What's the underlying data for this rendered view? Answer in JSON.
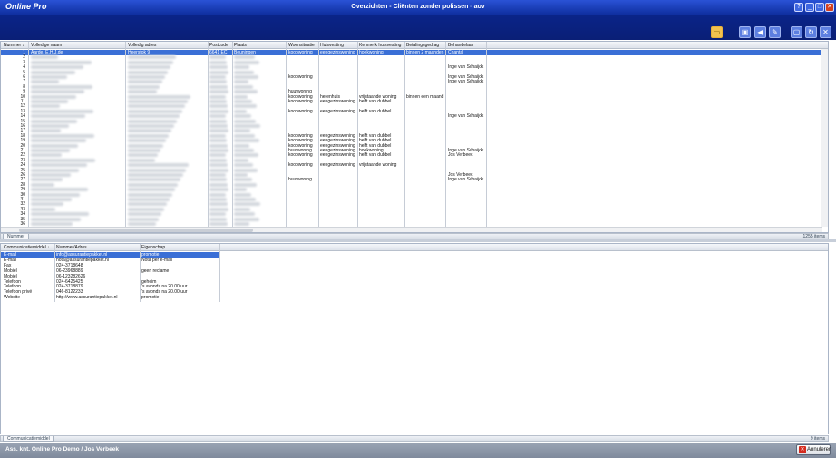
{
  "window": {
    "app_name": "Online Pro",
    "title": "Overzichten - Cliënten zonder polissen - aov",
    "buttons": [
      "?",
      "_",
      "□",
      "✕"
    ]
  },
  "toolbar": {
    "icons": [
      "folder-icon",
      "monitor-icon",
      "speaker-icon",
      "pen-icon",
      "window-icon",
      "refresh-icon",
      "close-panel-icon"
    ]
  },
  "clients": {
    "columns": [
      "Nummer ↓",
      "Volledige naam",
      "Volledig adres",
      "Postcode",
      "Plaats",
      "Woonsituatie",
      "Huisvesting",
      "Kenmerk huisvesting",
      "Betalingsgedrag",
      "Behandelaar"
    ],
    "rows": [
      {
        "nr": "1",
        "naam": "Aarde, E.H.J.de",
        "adres": "Heerstok 9",
        "postcode": "6641 EC",
        "plaats": "Beuningen",
        "woon": "koopwoning",
        "huis": "eengezinswoning",
        "kenmerk": "hoekwoning",
        "betaling": "binnen 2 maanden",
        "beh": "Chantal"
      },
      {
        "nr": "2",
        "woon": "",
        "huis": "",
        "kenmerk": "",
        "betaling": "",
        "beh": ""
      },
      {
        "nr": "3",
        "woon": "",
        "huis": "",
        "kenmerk": "",
        "betaling": "",
        "beh": ""
      },
      {
        "nr": "4",
        "woon": "",
        "huis": "",
        "kenmerk": "",
        "betaling": "",
        "beh": "Inge van Schaijck"
      },
      {
        "nr": "5",
        "woon": "",
        "huis": "",
        "kenmerk": "",
        "betaling": "",
        "beh": ""
      },
      {
        "nr": "6",
        "woon": "koopwoning",
        "huis": "",
        "kenmerk": "",
        "betaling": "",
        "beh": "Inge van Schaijck"
      },
      {
        "nr": "7",
        "woon": "",
        "huis": "",
        "kenmerk": "",
        "betaling": "",
        "beh": "Inge van Schaijck"
      },
      {
        "nr": "8",
        "woon": "",
        "huis": "",
        "kenmerk": "",
        "betaling": "",
        "beh": ""
      },
      {
        "nr": "9",
        "woon": "huurwoning",
        "huis": "",
        "kenmerk": "",
        "betaling": "",
        "beh": ""
      },
      {
        "nr": "10",
        "woon": "koopwoning",
        "huis": "herenhuis",
        "kenmerk": "vrijstaande woning",
        "betaling": "binnen een maand",
        "beh": ""
      },
      {
        "nr": "11",
        "woon": "koopwoning",
        "huis": "eengezinswoning",
        "kenmerk": "helft van dubbel",
        "betaling": "",
        "beh": ""
      },
      {
        "nr": "12",
        "woon": "",
        "huis": "",
        "kenmerk": "",
        "betaling": "",
        "beh": ""
      },
      {
        "nr": "13",
        "woon": "koopwoning",
        "huis": "eengezinswoning",
        "kenmerk": "helft van dubbel",
        "betaling": "",
        "beh": ""
      },
      {
        "nr": "14",
        "woon": "",
        "huis": "",
        "kenmerk": "",
        "betaling": "",
        "beh": "Inge van Schaijck"
      },
      {
        "nr": "15",
        "woon": "",
        "huis": "",
        "kenmerk": "",
        "betaling": "",
        "beh": ""
      },
      {
        "nr": "16",
        "woon": "",
        "huis": "",
        "kenmerk": "",
        "betaling": "",
        "beh": ""
      },
      {
        "nr": "17",
        "woon": "",
        "huis": "",
        "kenmerk": "",
        "betaling": "",
        "beh": ""
      },
      {
        "nr": "18",
        "woon": "koopwoning",
        "huis": "eengezinswoning",
        "kenmerk": "helft van dubbel",
        "betaling": "",
        "beh": ""
      },
      {
        "nr": "19",
        "woon": "koopwoning",
        "huis": "eengezinswoning",
        "kenmerk": "helft van dubbel",
        "betaling": "",
        "beh": ""
      },
      {
        "nr": "20",
        "woon": "koopwoning",
        "huis": "eengezinswoning",
        "kenmerk": "helft van dubbel",
        "betaling": "",
        "beh": ""
      },
      {
        "nr": "21",
        "woon": "huurwoning",
        "huis": "eengezinswoning",
        "kenmerk": "hoekwoning",
        "betaling": "",
        "beh": "Inge van Schaijck"
      },
      {
        "nr": "22",
        "woon": "koopwoning",
        "huis": "eengezinswoning",
        "kenmerk": "helft van dubbel",
        "betaling": "",
        "beh": "Jos Verbeek"
      },
      {
        "nr": "23",
        "woon": "",
        "huis": "",
        "kenmerk": "",
        "betaling": "",
        "beh": ""
      },
      {
        "nr": "24",
        "woon": "koopwoning",
        "huis": "eengezinswoning",
        "kenmerk": "vrijstaande woning",
        "betaling": "",
        "beh": ""
      },
      {
        "nr": "25",
        "woon": "",
        "huis": "",
        "kenmerk": "",
        "betaling": "",
        "beh": ""
      },
      {
        "nr": "26",
        "woon": "",
        "huis": "",
        "kenmerk": "",
        "betaling": "",
        "beh": "Jos Verbeek"
      },
      {
        "nr": "27",
        "woon": "huurwoning",
        "huis": "",
        "kenmerk": "",
        "betaling": "",
        "beh": "Inge van Schaijck"
      },
      {
        "nr": "28",
        "woon": "",
        "huis": "",
        "kenmerk": "",
        "betaling": "",
        "beh": ""
      },
      {
        "nr": "29",
        "woon": "",
        "huis": "",
        "kenmerk": "",
        "betaling": "",
        "beh": ""
      },
      {
        "nr": "30",
        "woon": "",
        "huis": "",
        "kenmerk": "",
        "betaling": "",
        "beh": ""
      },
      {
        "nr": "31",
        "woon": "",
        "huis": "",
        "kenmerk": "",
        "betaling": "",
        "beh": ""
      },
      {
        "nr": "32",
        "woon": "",
        "huis": "",
        "kenmerk": "",
        "betaling": "",
        "beh": ""
      },
      {
        "nr": "33",
        "woon": "",
        "huis": "",
        "kenmerk": "",
        "betaling": "",
        "beh": ""
      },
      {
        "nr": "34",
        "woon": "",
        "huis": "",
        "kenmerk": "",
        "betaling": "",
        "beh": ""
      },
      {
        "nr": "35",
        "woon": "",
        "huis": "",
        "kenmerk": "",
        "betaling": "",
        "beh": ""
      },
      {
        "nr": "36",
        "woon": "",
        "huis": "",
        "kenmerk": "",
        "betaling": "",
        "beh": ""
      }
    ],
    "status_tab": "Nummer",
    "status_count": "1255 items"
  },
  "comm": {
    "columns": [
      "Communicatiemiddel ↓",
      "Nummer/Adres",
      "Eigenschap"
    ],
    "rows": [
      {
        "middel": "E-mail",
        "adres": "info@assurantiepakket.nl",
        "eig": "promotie"
      },
      {
        "middel": "E-mail",
        "adres": "nota@assurantiepakket.nl",
        "eig": "Nota per e-mail"
      },
      {
        "middel": "Fax",
        "adres": "024-3718648",
        "eig": ""
      },
      {
        "middel": "Mobiel",
        "adres": "06-23968889",
        "eig": "geen reclame"
      },
      {
        "middel": "Mobiel",
        "adres": "06-123282626",
        "eig": ""
      },
      {
        "middel": "Telefoon",
        "adres": "024-6425425",
        "eig": "geheim"
      },
      {
        "middel": "Telefoon",
        "adres": "024-3718879",
        "eig": "'s avonds na 20.00 uur"
      },
      {
        "middel": "Telefoon privé",
        "adres": "046-8122233",
        "eig": "'s avonds na 20.00 uur"
      },
      {
        "middel": "Website",
        "adres": "http://www.assurantiepakket.nl",
        "eig": "promotie"
      }
    ],
    "status_tab": "Communicatiemiddel",
    "status_count": "9 items"
  },
  "footer": {
    "user": "Ass. knt. Online Pro Demo / Jos Verbeek",
    "cancel_label": "Annuleren"
  }
}
